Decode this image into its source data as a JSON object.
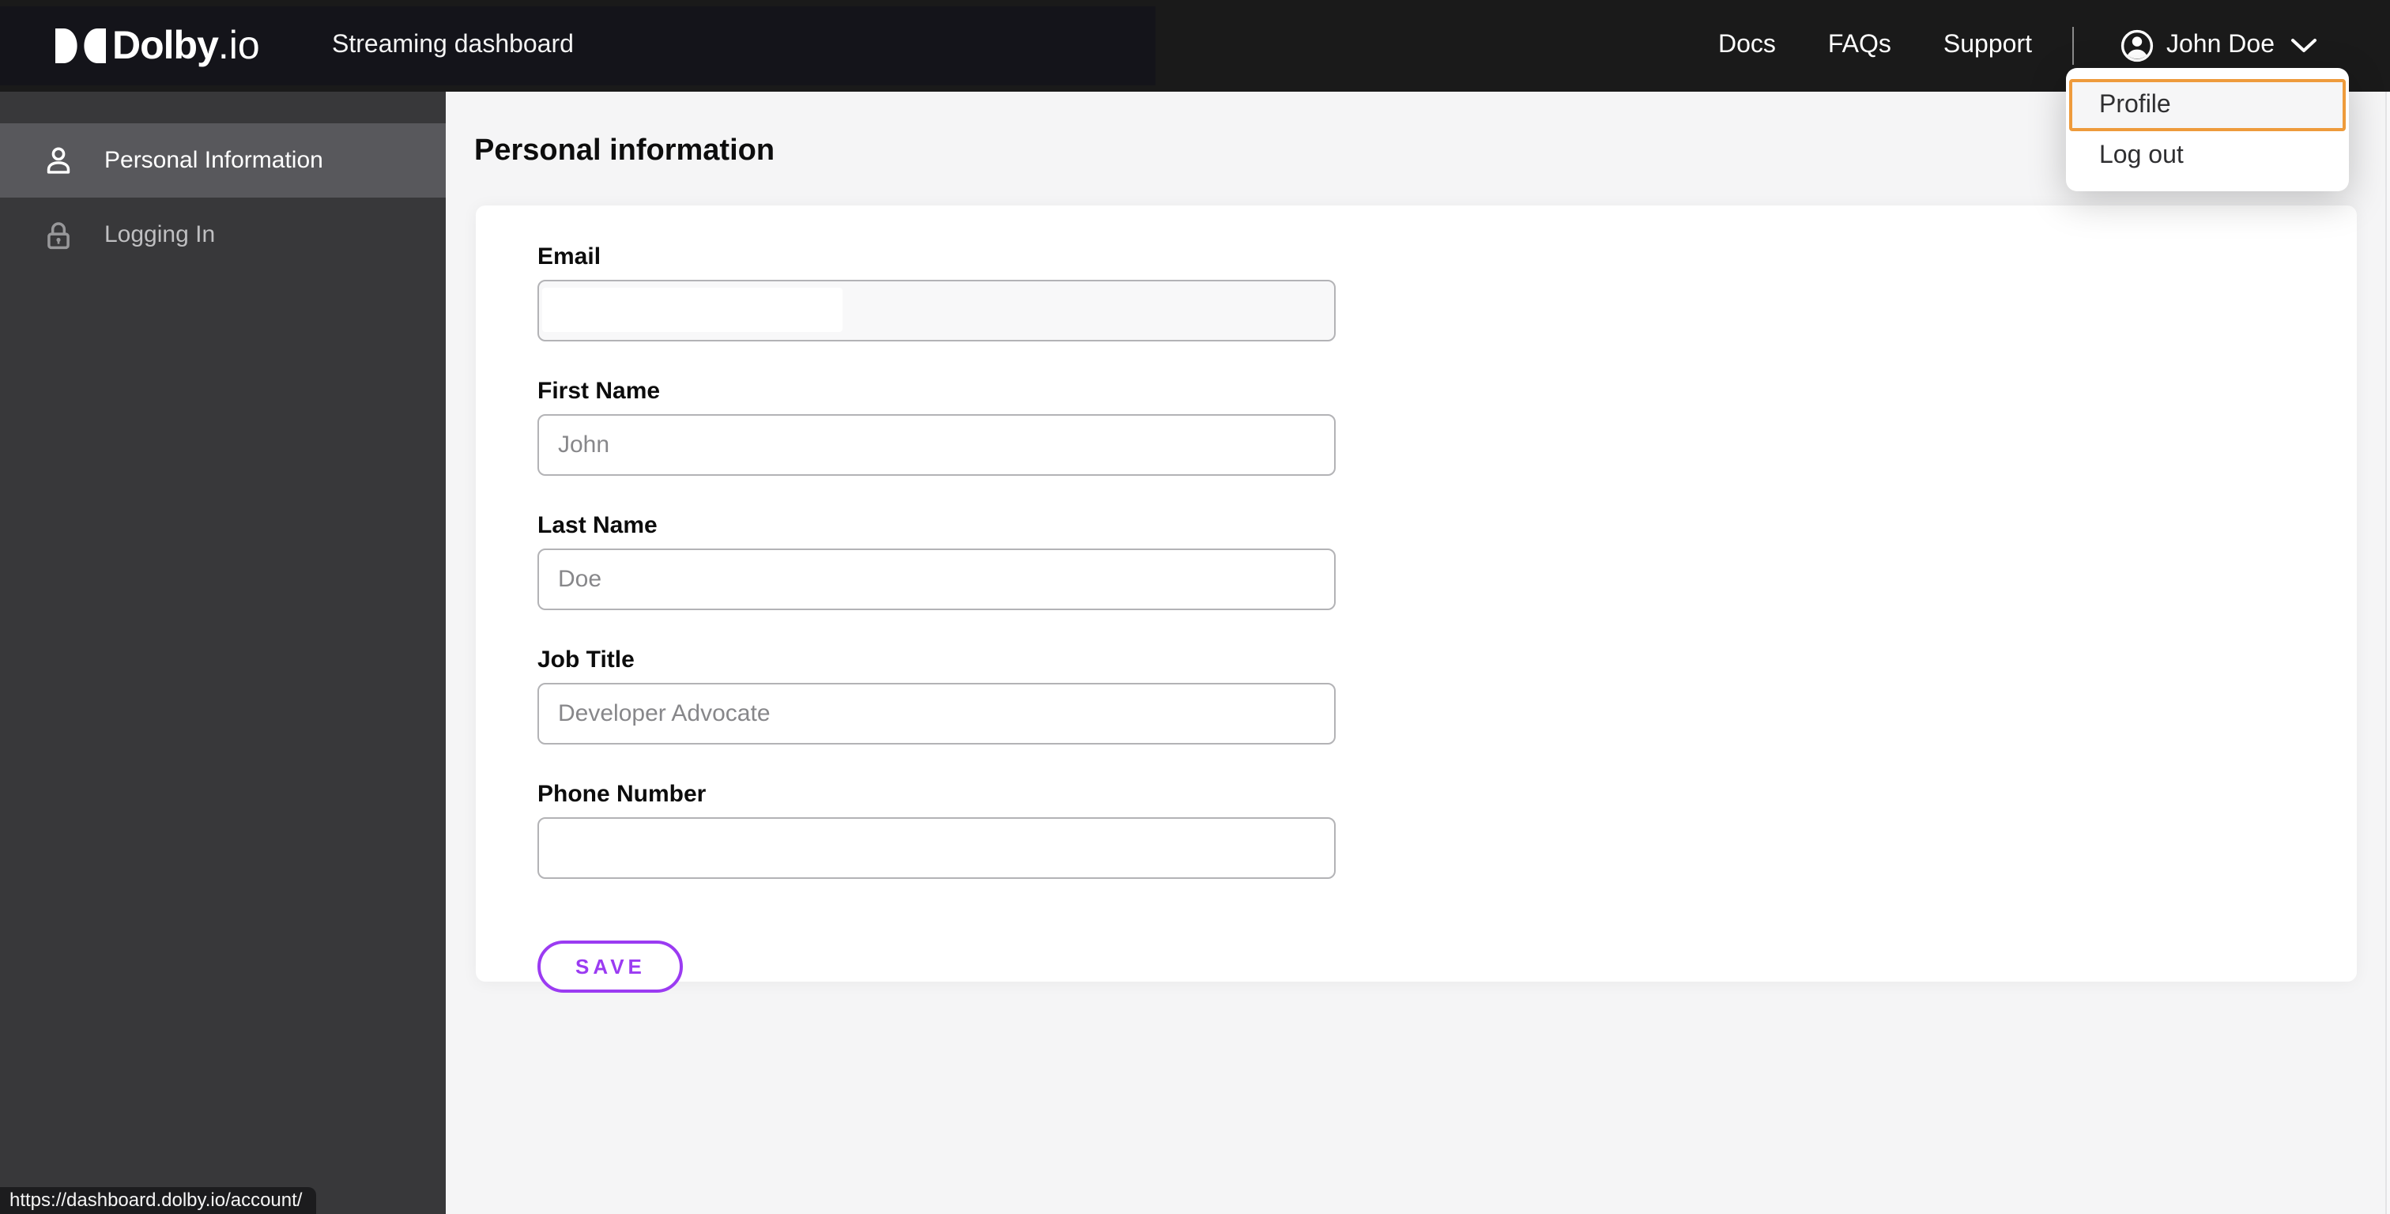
{
  "navbar": {
    "brand": {
      "name": "Dolby",
      "suffix": ".io"
    },
    "product_title": "Streaming dashboard",
    "links": [
      "Docs",
      "FAQs",
      "Support"
    ],
    "user": {
      "name": "John Doe"
    }
  },
  "user_menu": {
    "items": [
      {
        "label": "Profile",
        "focused": true
      },
      {
        "label": "Log out",
        "focused": false
      }
    ]
  },
  "sidebar": {
    "items": [
      {
        "label": "Personal Information",
        "icon": "person-icon",
        "active": true
      },
      {
        "label": "Logging In",
        "icon": "lock-icon",
        "active": false
      }
    ]
  },
  "main": {
    "title": "Personal information",
    "form": {
      "fields": [
        {
          "label": "Email",
          "value": "",
          "redacted": true
        },
        {
          "label": "First Name",
          "value": "John"
        },
        {
          "label": "Last Name",
          "value": "Doe"
        },
        {
          "label": "Job Title",
          "value": "Developer Advocate"
        },
        {
          "label": "Phone Number",
          "value": ""
        }
      ],
      "save_label": "SAVE"
    }
  },
  "status_bar": {
    "url": "https://dashboard.dolby.io/account/"
  },
  "colors": {
    "navbar_bg": "#1a1a1a",
    "sidebar_bg": "#38383a",
    "sidebar_active_bg": "#58585c",
    "page_bg": "#f5f5f6",
    "card_bg": "#ffffff",
    "accent_purple": "#9b3bf2",
    "focus_orange": "#ee9b3c",
    "input_border": "#b3b3b6"
  }
}
